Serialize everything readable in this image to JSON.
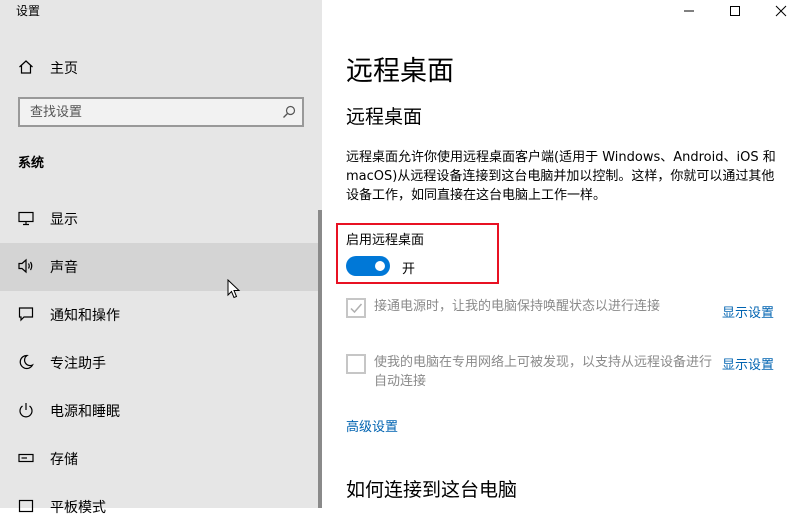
{
  "window": {
    "title": "设置"
  },
  "sidebar": {
    "home_label": "主页",
    "search_placeholder": "查找设置",
    "section_title": "系统",
    "items": [
      {
        "label": "显示",
        "icon": "monitor-icon"
      },
      {
        "label": "声音",
        "icon": "speaker-icon"
      },
      {
        "label": "通知和操作",
        "icon": "notification-icon"
      },
      {
        "label": "专注助手",
        "icon": "moon-icon"
      },
      {
        "label": "电源和睡眠",
        "icon": "power-icon"
      },
      {
        "label": "存储",
        "icon": "storage-icon"
      },
      {
        "label": "平板模式",
        "icon": "tablet-icon"
      }
    ]
  },
  "main": {
    "page_title": "远程桌面",
    "section_title": "远程桌面",
    "description": "远程桌面允许你使用远程桌面客户端(适用于 Windows、Android、iOS 和 macOS)从远程设备连接到这台电脑并加以控制。这样，你就可以通过其他设备工作，如同直接在这台电脑上工作一样。",
    "enable_label": "启用远程桌面",
    "toggle_state": "开",
    "options": [
      {
        "text": "接通电源时，让我的电脑保持唤醒状态以进行连接",
        "link": "显示设置",
        "checked": true
      },
      {
        "text": "使我的电脑在专用网络上可被发现，以支持从远程设备进行自动连接",
        "link": "显示设置",
        "checked": false
      }
    ],
    "advanced_link": "高级设置",
    "connect_heading": "如何连接到这台电脑"
  },
  "colors": {
    "accent": "#0078d7",
    "link": "#0063b1",
    "highlight": "#e81123",
    "sidebar_bg": "#e6e6e6"
  }
}
